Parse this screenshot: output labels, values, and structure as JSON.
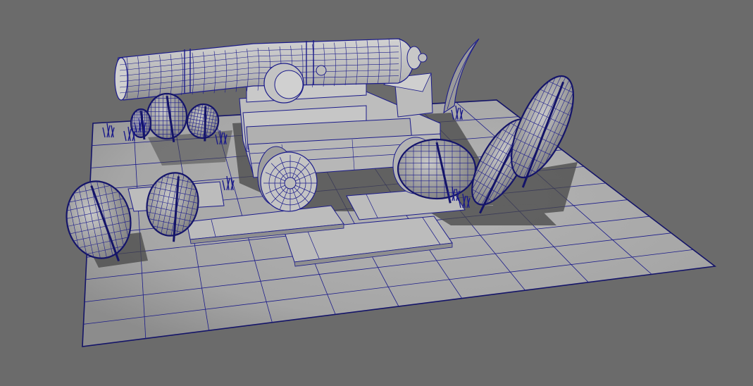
{
  "viewport": {
    "background_color": "#6b6b6b",
    "floor_color": "#a9a9a9",
    "floor_edge_color": "#141468",
    "wire_color": "#1b1b8a",
    "shadow_color": "#3f3f3f",
    "mesh_fill_color": "#b9b9b9",
    "leaf_fill_color": "#a2a2a2"
  },
  "scene": {
    "objects": [
      "cannon-barrel",
      "cannon-carriage",
      "cannon-wheel",
      "wooden-planks",
      "foliage-leaves",
      "grass-tufts",
      "ground-plane-grid"
    ]
  }
}
